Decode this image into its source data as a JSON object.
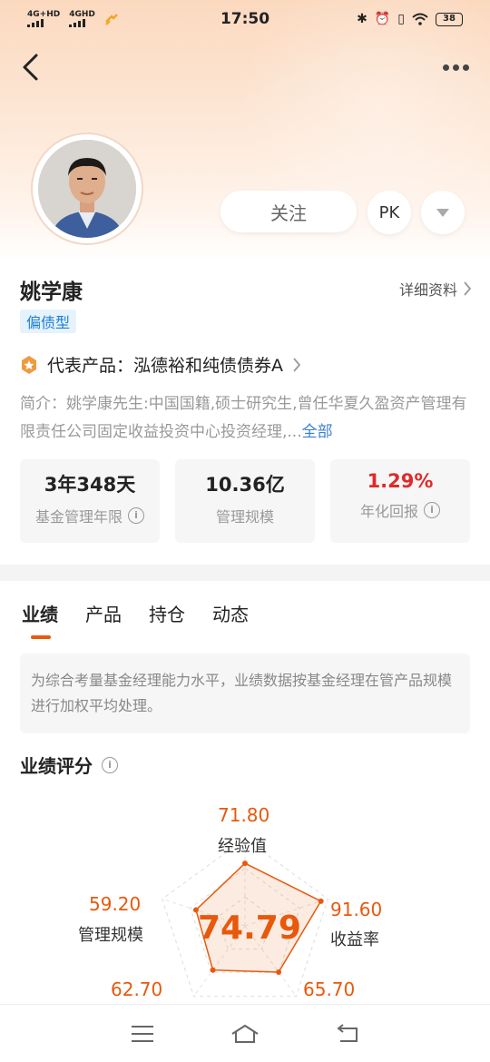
{
  "status_bar": {
    "net1": "4G+HD",
    "net2": "4GHD",
    "time": "17:50",
    "battery": "38"
  },
  "profile": {
    "name": "姚学康",
    "tag": "偏债型",
    "detail_link": "详细资料",
    "follow_label": "关注",
    "pk_label": "PK"
  },
  "rep_product": {
    "label": "代表产品：泓德裕和纯债债券A"
  },
  "intro": {
    "text": "简介：姚学康先生:中国国籍,硕士研究生,曾任华夏久盈资产管理有限责任公司固定收益投资中心投资经理,...",
    "more": "全部"
  },
  "stats": [
    {
      "value": "3年348天",
      "label": "基金管理年限"
    },
    {
      "value": "10.36亿",
      "label": "管理规模"
    },
    {
      "value": "1.29%",
      "label": "年化回报"
    }
  ],
  "tabs": [
    {
      "label": "业绩"
    },
    {
      "label": "产品"
    },
    {
      "label": "持仓"
    },
    {
      "label": "动态"
    }
  ],
  "notice": "为综合考量基金经理能力水平，业绩数据按基金经理在管产品规模进行加权平均处理。",
  "score_section": {
    "title": "业绩评分"
  },
  "radar": {
    "total": "74.79",
    "axes": [
      {
        "value": "71.80",
        "label": "经验值",
        "score": 71.8
      },
      {
        "value": "91.60",
        "label": "收益率",
        "score": 91.6
      },
      {
        "value": "65.70",
        "label": "",
        "score": 65.7
      },
      {
        "value": "62.70",
        "label": "",
        "score": 62.7
      },
      {
        "value": "59.20",
        "label": "管理规模",
        "score": 59.2
      }
    ],
    "accent": "#e8590c"
  },
  "colors": {
    "accent": "#e8590c",
    "link": "#3a7fd0",
    "tag_bg": "#e6f2fc",
    "tag_fg": "#1a7fd6",
    "positive": "#e02a2a"
  }
}
